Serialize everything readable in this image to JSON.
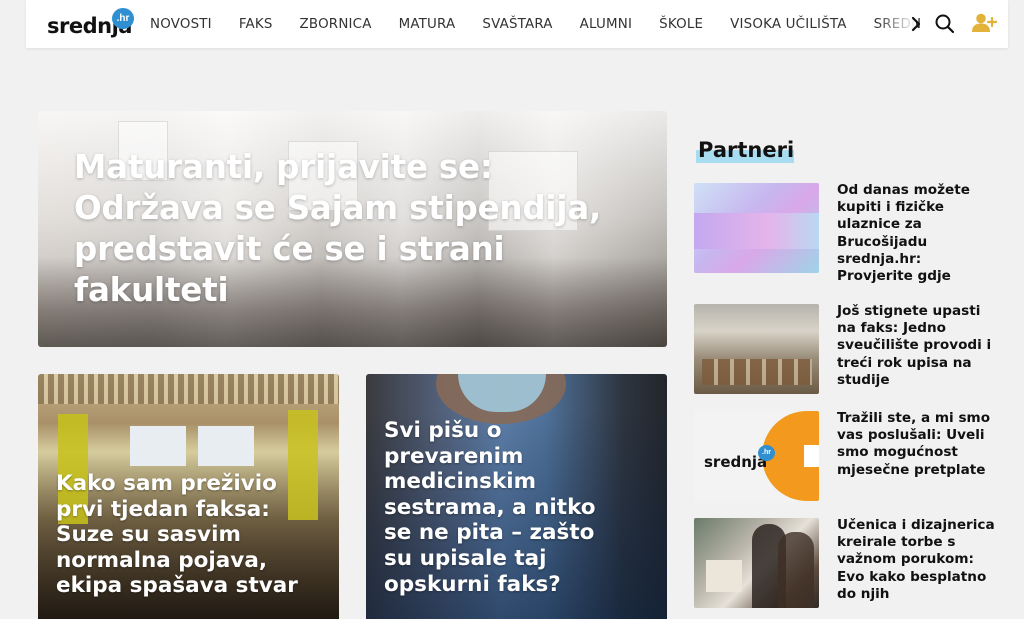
{
  "site": {
    "logo_text": "srednja",
    "logo_badge": ".hr"
  },
  "nav": {
    "items": [
      "NOVOSTI",
      "FAKS",
      "ZBORNICA",
      "MATURA",
      "SVAŠTARA",
      "ALUMNI",
      "ŠKOLE",
      "VISOKA UČILIŠTA",
      "SREDNJ"
    ],
    "icons": [
      "chevron-right-icon",
      "search-icon",
      "user-add-icon"
    ],
    "colors": {
      "user_icon": "#e2b23a",
      "badge": "#2f8fd0"
    }
  },
  "hero": {
    "title": "Maturanti, prijavite se: Održava se Sajam stipendija, predstavit će se i strani fakulteti"
  },
  "cards": [
    {
      "title": "Kako sam preživio prvi tjedan faksa: Suze su sasvim normalna pojava, ekipa spašava stvar"
    },
    {
      "title": "Svi pišu o prevarenim medicinskim sestrama, a nitko se ne pita – zašto su upisale taj opskurni faks?"
    }
  ],
  "sidebar": {
    "heading": "Partneri",
    "heading_highlight_color": "#a8dcf0",
    "items": [
      {
        "title": "Od danas možete kupiti i fizičke ulaznice za Brucošijadu srednja.hr: Provjerite gdje"
      },
      {
        "title": "Još stignete upasti na faks: Jedno sveučilište provodi i treći rok upisa na studije"
      },
      {
        "title": "Tražili ste, a mi smo vas poslušali: Uveli smo mogućnost mjesečne pretplate",
        "thumb_logo": "srednja",
        "thumb_badge": ".hr"
      },
      {
        "title": "Učenica i dizajnerica kreirale torbe s važnom porukom: Evo kako besplatno do njih"
      }
    ]
  }
}
